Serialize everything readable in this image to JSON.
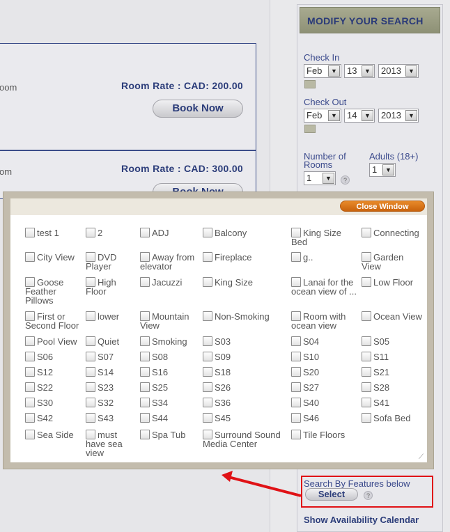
{
  "rooms": [
    {
      "desc": "oom",
      "rate": "Room Rate : CAD: 200.00",
      "button": "Book Now"
    },
    {
      "desc": "om",
      "rate": "Room Rate : CAD: 300.00",
      "button": "Book Now"
    }
  ],
  "sidebar": {
    "title": "MODIFY YOUR SEARCH",
    "check_in_label": "Check In",
    "check_in": {
      "month": "Feb",
      "day": "13",
      "year": "2013"
    },
    "check_out_label": "Check Out",
    "check_out": {
      "month": "Feb",
      "day": "14",
      "year": "2013"
    },
    "rooms_label_1": "Number of",
    "rooms_label_2": "Rooms",
    "rooms_value": "1",
    "adults_label": "Adults (18+)",
    "adults_value": "1",
    "features_label": "Search By Features below",
    "select_label": "Select",
    "help": "?",
    "availability_link": "Show Availability Calendar"
  },
  "popup": {
    "close_label": "Close Window",
    "features": [
      "test 1",
      "2",
      "ADJ",
      "Balcony",
      "King Size Bed",
      "Connecting",
      "City View",
      "DVD Player",
      "Away from elevator",
      "Fireplace",
      "g..",
      "Garden View",
      "Goose Feather Pillows",
      "High Floor",
      "Jacuzzi",
      "King Size",
      "Lanai for the ocean view of ...",
      "Low Floor",
      "First or Second Floor",
      "lower",
      "Mountain View",
      "Non-Smoking",
      "Room with ocean view",
      "Ocean View",
      "Pool View",
      "Quiet",
      "Smoking",
      "S03",
      "S04",
      "S05",
      "S06",
      "S07",
      "S08",
      "S09",
      "S10",
      "S11",
      "S12",
      "S14",
      "S16",
      "S18",
      "S20",
      "S21",
      "S22",
      "S23",
      "S25",
      "S26",
      "S27",
      "S28",
      "S30",
      "S32",
      "S34",
      "S36",
      "S40",
      "S41",
      "S42",
      "S43",
      "S44",
      "S45",
      "S46",
      "Sofa Bed",
      "Sea Side",
      "must have sea view",
      "Spa Tub",
      "Surround Sound Media Center",
      "Tile Floors"
    ]
  }
}
